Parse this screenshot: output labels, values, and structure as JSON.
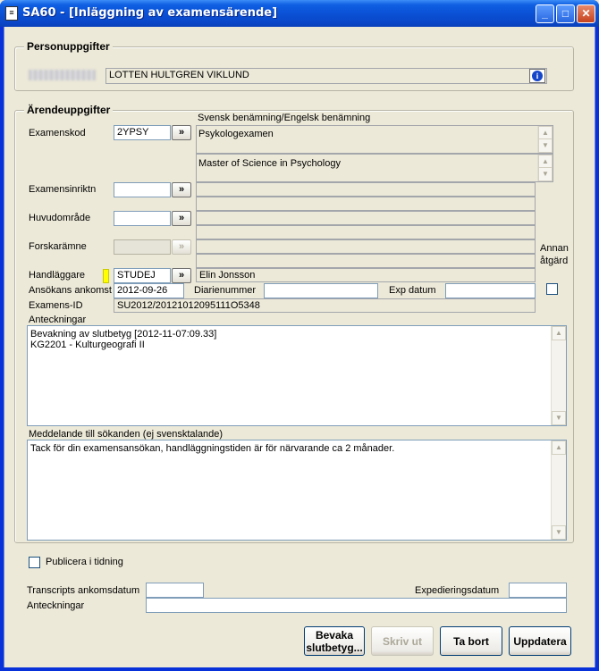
{
  "window": {
    "title": "SA60 - [Inläggning av examensärende]",
    "controls": {
      "minimize": "_",
      "maximize": "□",
      "close": "✕"
    }
  },
  "person": {
    "legend": "Personuppgifter",
    "name": "LOTTEN HULTGREN VIKLUND",
    "info_icon": "info-icon"
  },
  "arende": {
    "legend": "Ärendeuppgifter",
    "column_header": "Svensk benämning/Engelsk benämning",
    "examenskod": {
      "label": "Examenskod",
      "value": "2YPSY",
      "lookup": "»",
      "name_sv": "Psykologexamen",
      "name_en": "Master of Science in Psychology"
    },
    "examensinriktn": {
      "label": "Examensinriktn",
      "value": "",
      "lookup": "»"
    },
    "huvudomrade": {
      "label": "Huvudområde",
      "value": "",
      "lookup": "»"
    },
    "forskaramne": {
      "label": "Forskarämne",
      "value": "",
      "lookup": "»"
    },
    "handlaggare": {
      "label": "Handläggare",
      "value": "STUDEJ",
      "lookup": "»",
      "name": "Elin Jonsson"
    },
    "annan_atgard": {
      "label_line1": "Annan",
      "label_line2": "åtgärd",
      "checked": false
    },
    "ansokans_ankomst": {
      "label": "Ansökans ankomst",
      "value": "2012-09-26"
    },
    "diarienummer": {
      "label": "Diarienummer",
      "value": ""
    },
    "exp_datum": {
      "label": "Exp datum",
      "value": ""
    },
    "examens_id": {
      "label": "Examens-ID",
      "value": "SU2012/20121012095111O5348"
    }
  },
  "anteckningar": {
    "label": "Anteckningar",
    "lines": [
      "Bevakning av slutbetyg [2012-11-07:09.33]",
      "KG2201 - Kulturgeografi II"
    ]
  },
  "meddelande": {
    "label": "Meddelande till sökanden (ej svensktalande)",
    "text": "Tack för din examensansökan, handläggningstiden är för närvarande ca 2 månader."
  },
  "publicera": {
    "label": "Publicera i tidning",
    "checked": false
  },
  "transcripts": {
    "ankomst_label": "Transcripts ankomsdatum",
    "ankomst_value": "",
    "expediering_label": "Expedieringsdatum",
    "expediering_value": "",
    "anteckningar_label": "Anteckningar",
    "anteckningar_value": ""
  },
  "buttons": {
    "bevaka_line1": "Bevaka",
    "bevaka_line2": "slutbetyg...",
    "skriv_ut": "Skriv ut",
    "ta_bort": "Ta bort",
    "uppdatera": "Uppdatera"
  }
}
